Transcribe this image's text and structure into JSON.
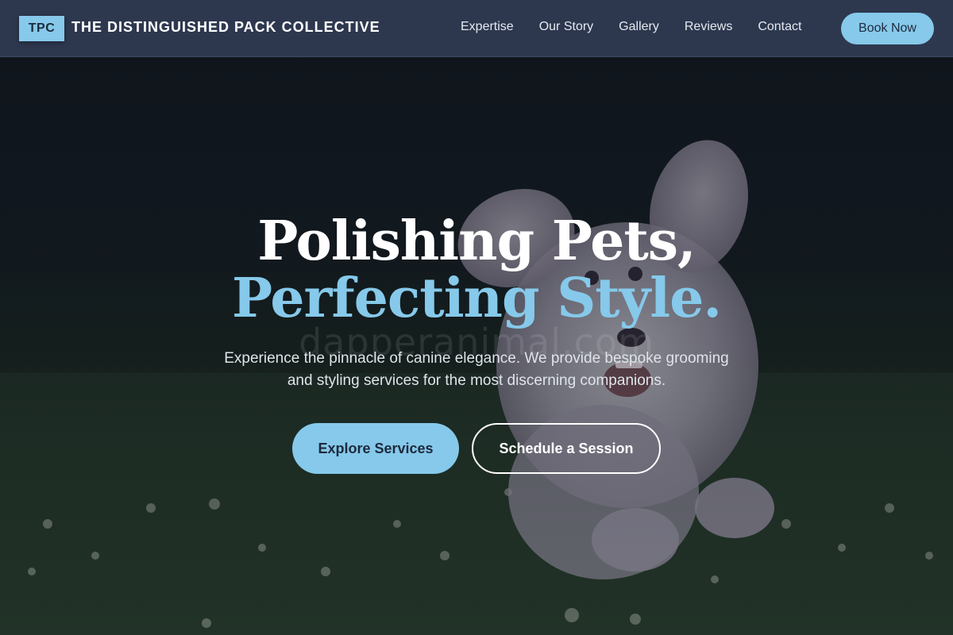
{
  "nav": {
    "logo_badge": "TPC",
    "brand": "THE DISTINGUISHED PACK COLLECTIVE",
    "links": [
      {
        "label": "Expertise"
      },
      {
        "label": "Our Story"
      },
      {
        "label": "Gallery"
      },
      {
        "label": "Reviews"
      },
      {
        "label": "Contact"
      }
    ],
    "book_button": "Book Now"
  },
  "hero": {
    "headline_line1": "Polishing Pets,",
    "headline_line2": "Perfecting Style.",
    "subtext": "Experience the pinnacle of canine elegance. We provide bespoke grooming and styling services for the most discerning companions.",
    "primary_cta": "Explore Services",
    "secondary_cta": "Schedule a Session",
    "watermark": "dapperanimal.com",
    "background_image": "fluffy-white-dog-running-on-grass"
  },
  "colors": {
    "nav_bg": "#2d384f",
    "accent": "#86c9ea",
    "text_dark": "#1d2a3d",
    "text_light": "#ffffff"
  }
}
